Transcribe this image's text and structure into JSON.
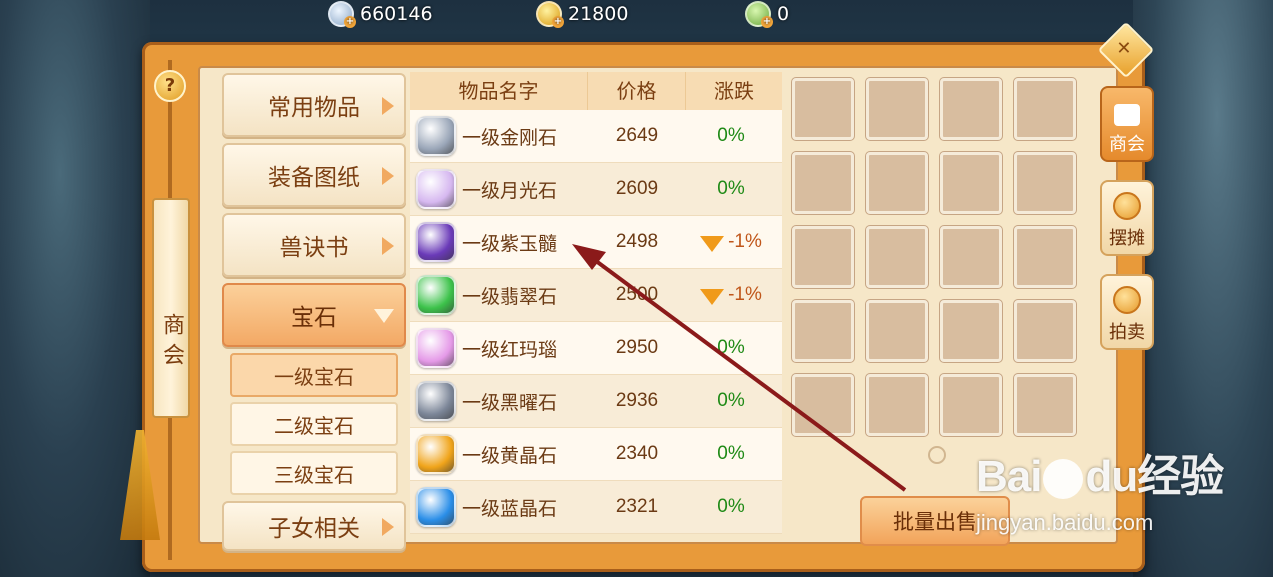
{
  "currencies": [
    {
      "name": "silver",
      "value": "660146",
      "color": "#a8c0dc"
    },
    {
      "name": "gold",
      "value": "21800",
      "color": "#f2c12c"
    },
    {
      "name": "jade",
      "value": "0",
      "color": "#8fcf5a"
    }
  ],
  "left_rail": {
    "help_label": "?",
    "title": "商会"
  },
  "categories": [
    {
      "label": "常用物品",
      "active": false
    },
    {
      "label": "装备图纸",
      "active": false
    },
    {
      "label": "兽诀书",
      "active": false
    },
    {
      "label": "宝石",
      "active": true
    },
    {
      "label": "子女相关",
      "active": false
    }
  ],
  "subcategories": [
    {
      "label": "一级宝石",
      "active": true
    },
    {
      "label": "二级宝石",
      "active": false
    },
    {
      "label": "三级宝石",
      "active": false
    }
  ],
  "table": {
    "headers": [
      "物品名字",
      "价格",
      "涨跌"
    ],
    "rows": [
      {
        "name": "一级金刚石",
        "price": "2649",
        "change": "0%",
        "trend": "flat",
        "gem_color": "#9aa6b8",
        "icon": "diamond-gem-icon"
      },
      {
        "name": "一级月光石",
        "price": "2609",
        "change": "0%",
        "trend": "flat",
        "gem_color": "#d6b8f0",
        "icon": "moonstone-gem-icon"
      },
      {
        "name": "一级紫玉髓",
        "price": "2498",
        "change": "-1%",
        "trend": "down",
        "gem_color": "#6a3ab8",
        "icon": "purple-chalcedony-gem-icon"
      },
      {
        "name": "一级翡翠石",
        "price": "2500",
        "change": "-1%",
        "trend": "down",
        "gem_color": "#3cc24a",
        "icon": "jade-gem-icon"
      },
      {
        "name": "一级红玛瑙",
        "price": "2950",
        "change": "0%",
        "trend": "flat",
        "gem_color": "#e59ae8",
        "icon": "red-agate-gem-icon"
      },
      {
        "name": "一级黑曜石",
        "price": "2936",
        "change": "0%",
        "trend": "flat",
        "gem_color": "#7c8698",
        "icon": "obsidian-gem-icon"
      },
      {
        "name": "一级黄晶石",
        "price": "2340",
        "change": "0%",
        "trend": "flat",
        "gem_color": "#f0a41a",
        "icon": "citrine-gem-icon"
      },
      {
        "name": "一级蓝晶石",
        "price": "2321",
        "change": "0%",
        "trend": "flat",
        "gem_color": "#2a8ee8",
        "icon": "kyanite-gem-icon"
      }
    ]
  },
  "sell_button": "批量出售",
  "right_tabs": [
    {
      "label": "商会",
      "active": true
    },
    {
      "label": "摆摊",
      "active": false
    },
    {
      "label": "拍卖",
      "active": false
    }
  ],
  "watermark": {
    "logo_left": "Bai",
    "logo_mid": "du",
    "logo_right": "经验",
    "url": "jingyan.baidu.com"
  },
  "colors": {
    "frame": "#e89a3a",
    "panel": "#f6e7c8",
    "zero_change": "#1f8a16",
    "negative_change": "#c0561a",
    "annotation_arrow": "#8b1a1a"
  }
}
